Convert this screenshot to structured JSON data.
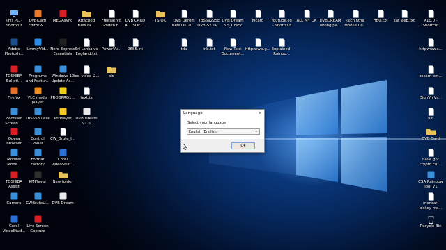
{
  "colors": {
    "desktop_blue": "#0f4a9e",
    "logo_glow": "#78beff",
    "ok_border": "#7aa7d8"
  },
  "desktop_icons": [
    {
      "label": "This PC -\nShortcut",
      "icon": "computer-icon",
      "color": "#6fb3ff"
    },
    {
      "label": "DvBjCam\nEditor &...",
      "icon": "app-icon",
      "color": "#e87a2a"
    },
    {
      "label": "MEGAsync",
      "icon": "app-icon",
      "color": "#d81f26"
    },
    {
      "label": "Attached\nFiles ok...",
      "icon": "folder-icon",
      "color": "#e8c25a"
    },
    {
      "label": "Freesat V8\nGolden F...",
      "icon": "file-icon",
      "color": "#ffffff"
    },
    {
      "label": "DVB CARD\nALL SOFT...",
      "icon": "file-icon",
      "color": "#ffffff"
    },
    {
      "label": "TS OK",
      "icon": "folder-icon",
      "color": "#e8c25a"
    },
    {
      "label": "DVB Derem\nNew OK 20...",
      "icon": "file-icon",
      "color": "#ffffff"
    },
    {
      "label": "TBS6922SE\nDVB-S2 TV...",
      "icon": "file-icon",
      "color": "#ffffff"
    },
    {
      "label": "DVB Dream\n3.5_Crack o...",
      "icon": "file-icon",
      "color": "#ffffff"
    },
    {
      "label": "Mcard",
      "icon": "file-icon",
      "color": "#ffffff"
    },
    {
      "label": "Youtube.co\n- Shortcut",
      "icon": "file-icon",
      "color": "#ffffff"
    },
    {
      "label": "ALL MY OK",
      "icon": "file-icon",
      "color": "#ffffff"
    },
    {
      "label": "DVBDREAM\nwrong pa...",
      "icon": "file-icon",
      "color": "#ffffff"
    },
    {
      "label": "@chintha\nMobile Co...",
      "icon": "file-icon",
      "color": "#ffffff"
    },
    {
      "label": "HBO.txt",
      "icon": "file-icon",
      "color": "#ffffff"
    },
    {
      "label": "sat web.txt",
      "icon": "file-icon",
      "color": "#ffffff"
    },
    {
      "label": "X10.0 -\nShortcut",
      "icon": "file-icon",
      "color": "#ffffff"
    },
    {
      "label": "Adobe\nPhotosh...",
      "icon": "app-icon",
      "color": "#1d4e89"
    },
    {
      "label": "UmmyVid...",
      "icon": "app-icon",
      "color": "#2a8de8"
    },
    {
      "label": "Nero Express\nEssentials",
      "icon": "app-icon",
      "color": "#202020"
    },
    {
      "label": "Sri Lanka vs\nEngland.txt",
      "icon": "file-icon",
      "color": "#ffffff"
    },
    {
      "label": "PowerVu...",
      "icon": "file-icon",
      "color": "#ffffff"
    },
    {
      "label": "0685.ini",
      "icon": "file-icon",
      "color": "#ffffff"
    },
    {
      "label": "tda",
      "icon": "file-icon",
      "color": "#ffffff"
    },
    {
      "label": "lnb.txt",
      "icon": "file-icon",
      "color": "#ffffff"
    },
    {
      "label": "New Text\nDocument...",
      "icon": "file-icon",
      "color": "#ffffff"
    },
    {
      "label": "http:www.g...",
      "icon": "file-icon",
      "color": "#ffffff"
    },
    {
      "label": "Explained!\nRainbo...",
      "icon": "file-icon",
      "color": "#ffffff"
    },
    {
      "label": "httpwww.s...",
      "icon": "file-icon",
      "color": "#ffffff"
    },
    {
      "label": "TOSHIBA\nBulleti...",
      "icon": "app-icon",
      "color": "#d81f26"
    },
    {
      "label": "Programs\nand Featur...",
      "icon": "app-icon",
      "color": "#3a8fd8"
    },
    {
      "label": "Windows 10\nUpdate As...",
      "icon": "app-icon",
      "color": "#3a8fd8"
    },
    {
      "label": "ice_video_2...",
      "icon": "file-icon",
      "color": "#ffffff"
    },
    {
      "label": "old",
      "icon": "folder-icon",
      "color": "#e8c25a"
    },
    {
      "label": "oscam-em...",
      "icon": "file-icon",
      "color": "#ffffff"
    },
    {
      "label": "Firefox",
      "icon": "app-icon",
      "color": "#e8702a"
    },
    {
      "label": "VLC media\nplayer",
      "icon": "app-icon",
      "color": "#f08c1e"
    },
    {
      "label": "PROGPRO1...",
      "icon": "app-icon",
      "color": "#f0d01e"
    },
    {
      "label": "text.ts",
      "icon": "file-icon",
      "color": "#ffffff"
    },
    {
      "label": "DjghVjyVs...",
      "icon": "file-icon",
      "color": "#ffffff"
    },
    {
      "label": "Icecream\nScreen ...",
      "icon": "app-icon",
      "color": "#3a8fd8"
    },
    {
      "label": "TBS5580.exe",
      "icon": "app-icon",
      "color": "#3a8fd8"
    },
    {
      "label": "PotPlayer",
      "icon": "app-icon",
      "color": "#f0c81e"
    },
    {
      "label": "DVB Dream\nv1.6",
      "icon": "app-icon",
      "color": "#e8e8e8"
    },
    {
      "label": "vlc",
      "icon": "file-icon",
      "color": "#ffffff"
    },
    {
      "label": "Opera\nbrowser",
      "icon": "app-icon",
      "color": "#d81f26"
    },
    {
      "label": "Control\nPanel",
      "icon": "app-icon",
      "color": "#3a8fd8"
    },
    {
      "label": "CW_Brute_l...",
      "icon": "file-icon",
      "color": "#ffffff"
    },
    {
      "label": "DVB Card",
      "icon": "folder-icon",
      "color": "#e8c25a"
    },
    {
      "label": "Mobitel\nMobil...",
      "icon": "app-icon",
      "color": "#3a8fd8"
    },
    {
      "label": "Format\nFactory",
      "icon": "app-icon",
      "color": "#3a8fd8"
    },
    {
      "label": "Corel\nVideoStud...",
      "icon": "app-icon",
      "color": "#2a6fd8"
    },
    {
      "label": "have got\ncrypt8 c8 ...",
      "icon": "file-icon",
      "color": "#ffffff"
    },
    {
      "label": "TOSHIBA\nAssist",
      "icon": "app-icon",
      "color": "#d81f26"
    },
    {
      "label": "KMPlayer",
      "icon": "app-icon",
      "color": "#303030"
    },
    {
      "label": "New folder",
      "icon": "folder-icon",
      "color": "#e8c25a"
    },
    {
      "label": "CSA Rainbow\nTool V1",
      "icon": "app-icon",
      "color": "#3a8fd8"
    },
    {
      "label": "Camera",
      "icon": "app-icon",
      "color": "#3a8fd8"
    },
    {
      "label": "CWBruteLi...",
      "icon": "app-icon",
      "color": "#3a8fd8"
    },
    {
      "label": "DVB Dream",
      "icon": "app-icon",
      "color": "#e8e8e8"
    },
    {
      "label": "mencari\nbiskey me...",
      "icon": "file-icon",
      "color": "#ffffff"
    },
    {
      "label": "Corel\nVideoStud...",
      "icon": "app-icon",
      "color": "#2a6fd8"
    },
    {
      "label": "Live Screen\nCapture",
      "icon": "app-icon",
      "color": "#d81f26"
    },
    {
      "label": "Recycle Bin",
      "icon": "recycle-bin-icon",
      "color": "#e8e8e8"
    }
  ],
  "dialog": {
    "title": "Language",
    "close_glyph": "✕",
    "prompt": "Select your language",
    "selected_language": "English (English)",
    "ok_label": "Ok"
  }
}
